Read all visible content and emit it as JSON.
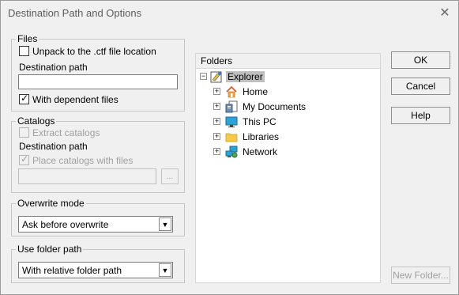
{
  "window": {
    "title": "Destination Path and Options"
  },
  "files": {
    "group_label": "Files",
    "unpack_label": "Unpack to the .ctf file location",
    "unpack_checked": false,
    "dest_path_label": "Destination path",
    "dest_path_value": "",
    "dependent_label": "With dependent files",
    "dependent_checked": true
  },
  "catalogs": {
    "group_label": "Catalogs",
    "extract_label": "Extract catalogs",
    "dest_path_label": "Destination path",
    "place_label": "Place catalogs with files",
    "path_value": "",
    "browse_label": "..."
  },
  "overwrite": {
    "group_label": "Overwrite mode",
    "selected": "Ask before overwrite"
  },
  "folder_path": {
    "group_label": "Use folder path",
    "selected": "With relative folder path"
  },
  "folders": {
    "header": "Folders",
    "root": "Explorer",
    "items": [
      "Home",
      "My Documents",
      "This PC",
      "Libraries",
      "Network"
    ]
  },
  "buttons": {
    "ok": "OK",
    "cancel": "Cancel",
    "help": "Help",
    "new_folder": "New Folder..."
  }
}
